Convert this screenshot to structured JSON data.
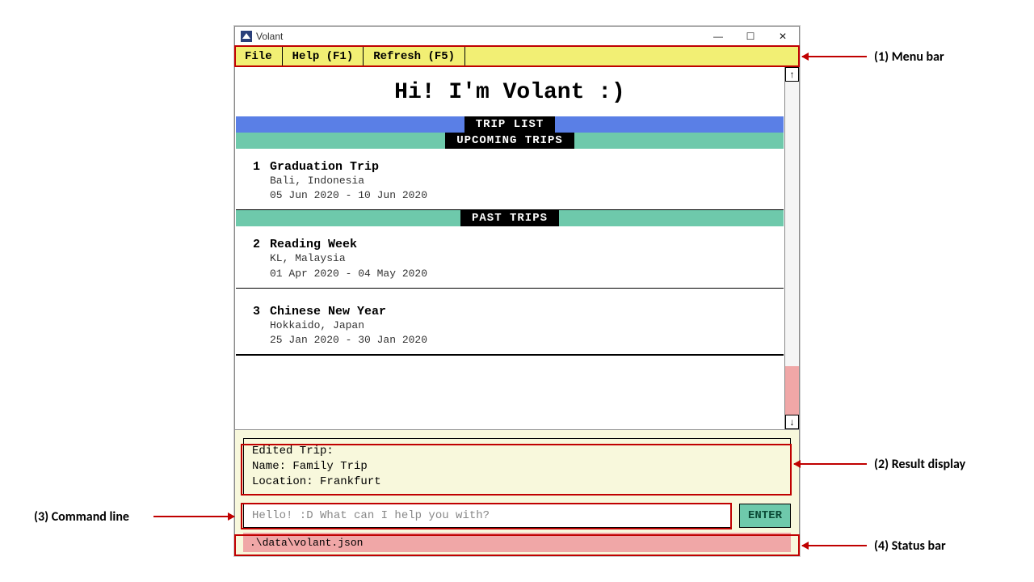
{
  "window": {
    "title": "Volant"
  },
  "menu": {
    "items": [
      "File",
      "Help (F1)",
      "Refresh (F5)"
    ]
  },
  "greeting": "Hi! I'm Volant :)",
  "sections": {
    "trip_list": "TRIP LIST",
    "upcoming": "UPCOMING TRIPS",
    "past": "PAST TRIPS"
  },
  "upcoming_trips": [
    {
      "index": "1",
      "title": "Graduation Trip",
      "location": "Bali, Indonesia",
      "dates": "05 Jun 2020 - 10 Jun 2020"
    }
  ],
  "past_trips": [
    {
      "index": "2",
      "title": "Reading Week",
      "location": "KL, Malaysia",
      "dates": "01 Apr 2020 - 04 May 2020"
    },
    {
      "index": "3",
      "title": "Chinese New Year",
      "location": "Hokkaido, Japan",
      "dates": "25 Jan 2020 - 30 Jan 2020"
    }
  ],
  "result_display": "Edited Trip:\nName: Family Trip\nLocation: Frankfurt",
  "command_line": {
    "placeholder": "Hello! :D What can I help you with?"
  },
  "enter_button": "ENTER",
  "status_bar": ".\\data\\volant.json",
  "annotations": {
    "menu": "(1) Menu bar",
    "result": "(2) Result display",
    "cmd": "(3) Command line",
    "status": "(4) Status bar"
  }
}
